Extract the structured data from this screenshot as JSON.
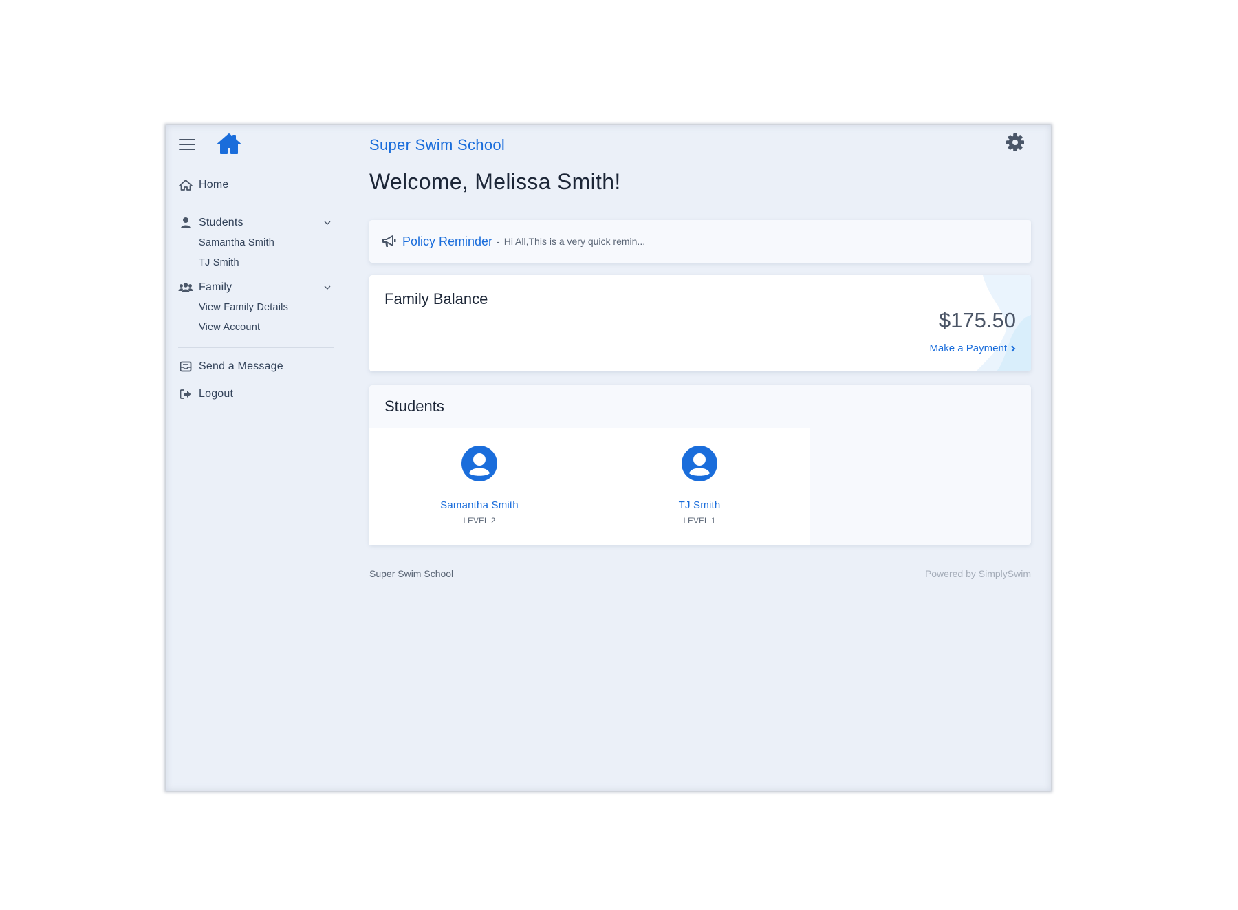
{
  "header": {
    "school_name": "Super Swim School",
    "welcome": "Welcome, Melissa Smith!"
  },
  "sidebar": {
    "home": "Home",
    "students_label": "Students",
    "students": [
      "Samantha Smith",
      "TJ Smith"
    ],
    "family_label": "Family",
    "family_items": [
      "View Family Details",
      "View Account"
    ],
    "send_message": "Send a Message",
    "logout": "Logout"
  },
  "policy": {
    "title": "Policy Reminder",
    "separator": "-",
    "preview": "Hi All,This is a very quick remin..."
  },
  "balance": {
    "title": "Family Balance",
    "amount": "$175.50",
    "pay_label": "Make a Payment"
  },
  "students_card": {
    "title": "Students",
    "items": [
      {
        "name": "Samantha Smith",
        "level": "LEVEL 2"
      },
      {
        "name": "TJ Smith",
        "level": "LEVEL 1"
      }
    ]
  },
  "footer": {
    "left": "Super Swim School",
    "right": "Powered by SimplySwim"
  },
  "colors": {
    "accent": "#1a6ddb",
    "background": "#ebf0f8",
    "text": "#33435a"
  }
}
